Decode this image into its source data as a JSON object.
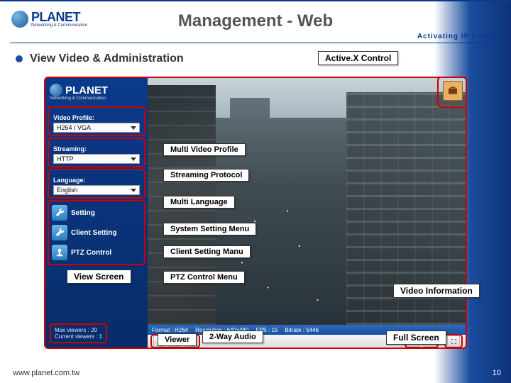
{
  "brand": {
    "name": "PLANET",
    "sub": "Networking & Communication",
    "tagline": "Activating IP Power"
  },
  "title": "Management - Web",
  "bullet": "View Video & Administration",
  "sidepanel": {
    "profile_label": "Video Profile:",
    "profile_value": "H264 / VGA",
    "streaming_label": "Streaming:",
    "streaming_value": "HTTP",
    "language_label": "Language:",
    "language_value": "English",
    "btn_setting": "Setting",
    "btn_client": "Client Setting",
    "btn_ptz": "PTZ Control",
    "max_viewers": "Max viewers : 20",
    "current_viewers": "Current viewers :  1"
  },
  "infobar": {
    "format": "Format : H264",
    "resolution": "Resolution : 640x480",
    "fps": "FPS : 15",
    "bitrate": "Bitrate : 5446"
  },
  "callouts": {
    "activex": "Active.X Control",
    "multi_profile": "Multi Video Profile",
    "streaming_protocol": "Streaming Protocol",
    "multi_language": "Multi Language",
    "system_setting": "System Setting Menu",
    "client_setting": "Client Setting Manu",
    "ptz_menu": "PTZ Control Menu",
    "view_screen": "View Screen",
    "video_info": "Video Information",
    "viewer": "Viewer",
    "two_way_audio": "2-Way Audio",
    "full_screen": "Full Screen"
  },
  "footer": "www.planet.com.tw",
  "pagenum": "10"
}
